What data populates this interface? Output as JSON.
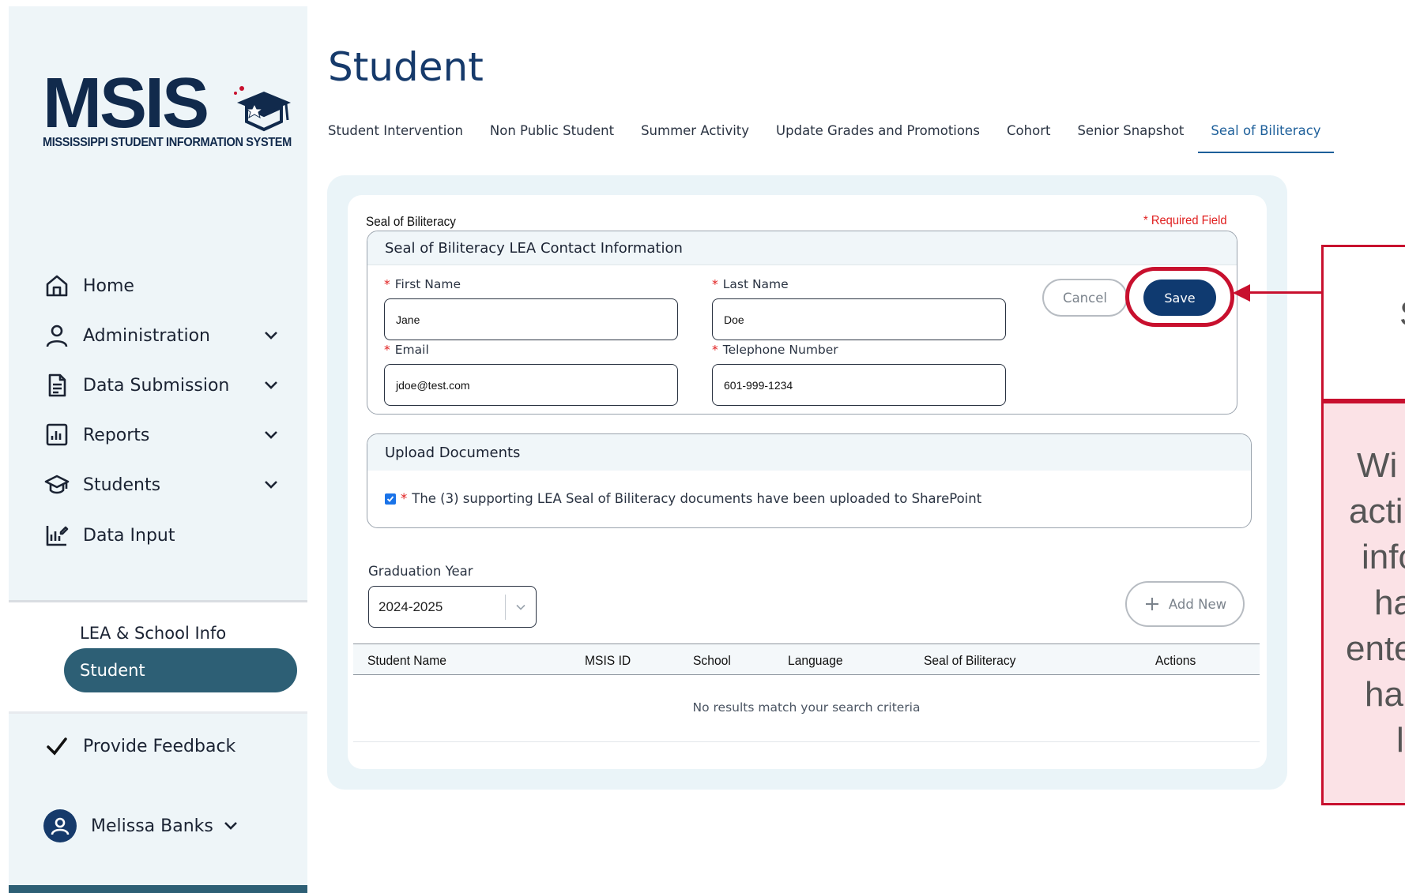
{
  "logo": {
    "text": "MSIS",
    "subtitle": "MISSISSIPPI STUDENT INFORMATION SYSTEM"
  },
  "sidebar": {
    "items": [
      {
        "label": "Home",
        "icon": "home-icon"
      },
      {
        "label": "Administration",
        "icon": "user-icon",
        "expandable": true
      },
      {
        "label": "Data Submission",
        "icon": "document-icon",
        "expandable": true
      },
      {
        "label": "Reports",
        "icon": "chart-icon",
        "expandable": true
      },
      {
        "label": "Students",
        "icon": "graduation-cap-icon",
        "expandable": true
      },
      {
        "label": "Data Input",
        "icon": "data-input-icon"
      }
    ],
    "sub_items": [
      {
        "label": "LEA & School Info"
      },
      {
        "label": "Student",
        "active": true
      }
    ],
    "feedback": "Provide Feedback",
    "user_name": "Melissa Banks"
  },
  "page": {
    "title": "Student",
    "tabs": [
      {
        "label": "Student Intervention"
      },
      {
        "label": "Non Public Student"
      },
      {
        "label": "Summer Activity"
      },
      {
        "label": "Update Grades and Promotions"
      },
      {
        "label": "Cohort"
      },
      {
        "label": "Senior Snapshot"
      },
      {
        "label": "Seal of Biliteracy",
        "active": true
      }
    ]
  },
  "form": {
    "section_label": "Seal of Biliteracy",
    "required_note": "* Required Field",
    "contact": {
      "heading": "Seal of Biliteracy LEA Contact Information",
      "first_name_label": "First Name",
      "first_name": "Jane",
      "last_name_label": "Last Name",
      "last_name": "Doe",
      "email_label": "Email",
      "email": "jdoe@test.com",
      "phone_label": "Telephone Number",
      "phone": "601-999-1234",
      "cancel_label": "Cancel",
      "save_label": "Save"
    },
    "upload": {
      "heading": "Upload Documents",
      "checkbox_text": "The (3) supporting LEA Seal of Biliteracy documents have been uploaded to SharePoint",
      "checked": true
    },
    "graduation_year_label": "Graduation Year",
    "graduation_year": "2024-2025",
    "add_new_label": "Add New"
  },
  "table": {
    "columns": [
      "Student Name",
      "MSIS ID",
      "School",
      "Language",
      "Seal of Biliteracy",
      "Actions"
    ],
    "rows": [],
    "empty_message": "No results match your search criteria"
  },
  "callout": {
    "top_text": "S",
    "lines": [
      "Wi",
      "acti",
      "info",
      "ha",
      "ente",
      "ha",
      "l"
    ]
  },
  "colors": {
    "brand_navy": "#0f3a70",
    "active_teal": "#2d5f75",
    "annotation_red": "#c8102e",
    "required_red": "#e01d1d",
    "callout_pink": "#fbe2e6"
  }
}
